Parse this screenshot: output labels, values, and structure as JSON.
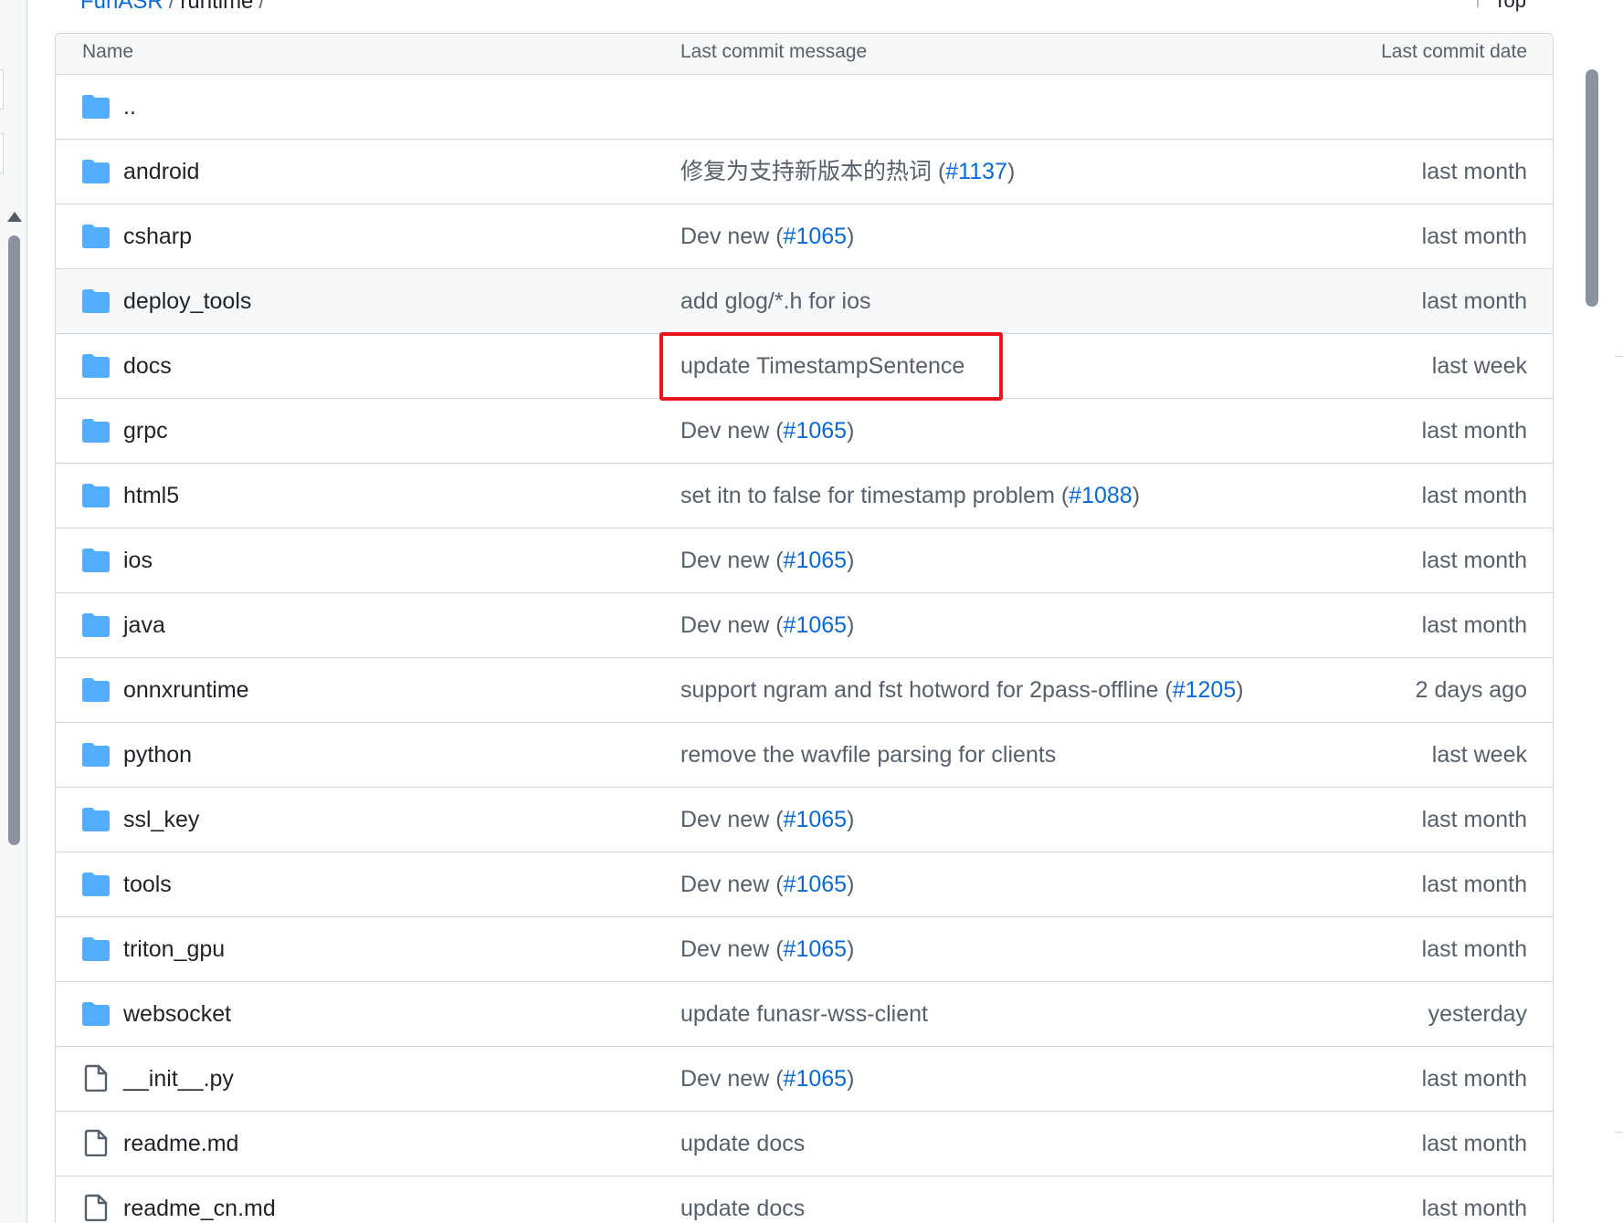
{
  "breadcrumb": {
    "repo": "FunASR",
    "separator": "/",
    "current": "runtime",
    "trailing_separator": "/"
  },
  "top_link": {
    "label": "Top",
    "icon": "arrow-up-icon"
  },
  "table": {
    "headers": {
      "name": "Name",
      "message": "Last commit message",
      "date": "Last commit date"
    },
    "parent": {
      "name": "..",
      "icon": "folder-icon"
    },
    "rows": [
      {
        "type": "dir",
        "icon": "folder-icon",
        "name": "android",
        "msg": "修复为支持新版本的热词 (",
        "pr": "#1137",
        "msg_end": ")",
        "date": "last month"
      },
      {
        "type": "dir",
        "icon": "folder-icon",
        "name": "csharp",
        "msg": "Dev new (",
        "pr": "#1065",
        "msg_end": ")",
        "date": "last month"
      },
      {
        "type": "dir",
        "icon": "folder-icon",
        "name": "deploy_tools",
        "msg": "add glog/*.h for ios",
        "pr": "",
        "msg_end": "",
        "date": "last month"
      },
      {
        "type": "dir",
        "icon": "folder-icon",
        "name": "docs",
        "msg": "update TimestampSentence",
        "pr": "",
        "msg_end": "",
        "date": "last week"
      },
      {
        "type": "dir",
        "icon": "folder-icon",
        "name": "grpc",
        "msg": "Dev new (",
        "pr": "#1065",
        "msg_end": ")",
        "date": "last month"
      },
      {
        "type": "dir",
        "icon": "folder-icon",
        "name": "html5",
        "msg": "set itn to false for timestamp problem (",
        "pr": "#1088",
        "msg_end": ")",
        "date": "last month"
      },
      {
        "type": "dir",
        "icon": "folder-icon",
        "name": "ios",
        "msg": "Dev new (",
        "pr": "#1065",
        "msg_end": ")",
        "date": "last month"
      },
      {
        "type": "dir",
        "icon": "folder-icon",
        "name": "java",
        "msg": "Dev new (",
        "pr": "#1065",
        "msg_end": ")",
        "date": "last month"
      },
      {
        "type": "dir",
        "icon": "folder-icon",
        "name": "onnxruntime",
        "msg": "support ngram and fst hotword for 2pass-offline (",
        "pr": "#1205",
        "msg_end": ")",
        "date": "2 days ago"
      },
      {
        "type": "dir",
        "icon": "folder-icon",
        "name": "python",
        "msg": "remove the wavfile parsing for clients",
        "pr": "",
        "msg_end": "",
        "date": "last week"
      },
      {
        "type": "dir",
        "icon": "folder-icon",
        "name": "ssl_key",
        "msg": "Dev new (",
        "pr": "#1065",
        "msg_end": ")",
        "date": "last month"
      },
      {
        "type": "dir",
        "icon": "folder-icon",
        "name": "tools",
        "msg": "Dev new (",
        "pr": "#1065",
        "msg_end": ")",
        "date": "last month"
      },
      {
        "type": "dir",
        "icon": "folder-icon",
        "name": "triton_gpu",
        "msg": "Dev new (",
        "pr": "#1065",
        "msg_end": ")",
        "date": "last month"
      },
      {
        "type": "dir",
        "icon": "folder-icon",
        "name": "websocket",
        "msg": "update funasr-wss-client",
        "pr": "",
        "msg_end": "",
        "date": "yesterday"
      },
      {
        "type": "file",
        "icon": "file-icon",
        "name": "__init__.py",
        "msg": "Dev new (",
        "pr": "#1065",
        "msg_end": ")",
        "date": "last month"
      },
      {
        "type": "file",
        "icon": "file-icon",
        "name": "readme.md",
        "msg": "update docs",
        "pr": "",
        "msg_end": "",
        "date": "last month"
      },
      {
        "type": "file",
        "icon": "file-icon",
        "name": "readme_cn.md",
        "msg": "update docs",
        "pr": "",
        "msg_end": "",
        "date": "last month"
      }
    ]
  },
  "colors": {
    "link": "#0969da",
    "muted": "#57606a",
    "folder": "#54aeff",
    "highlight": "#e8131b",
    "border": "#d0d7de"
  }
}
